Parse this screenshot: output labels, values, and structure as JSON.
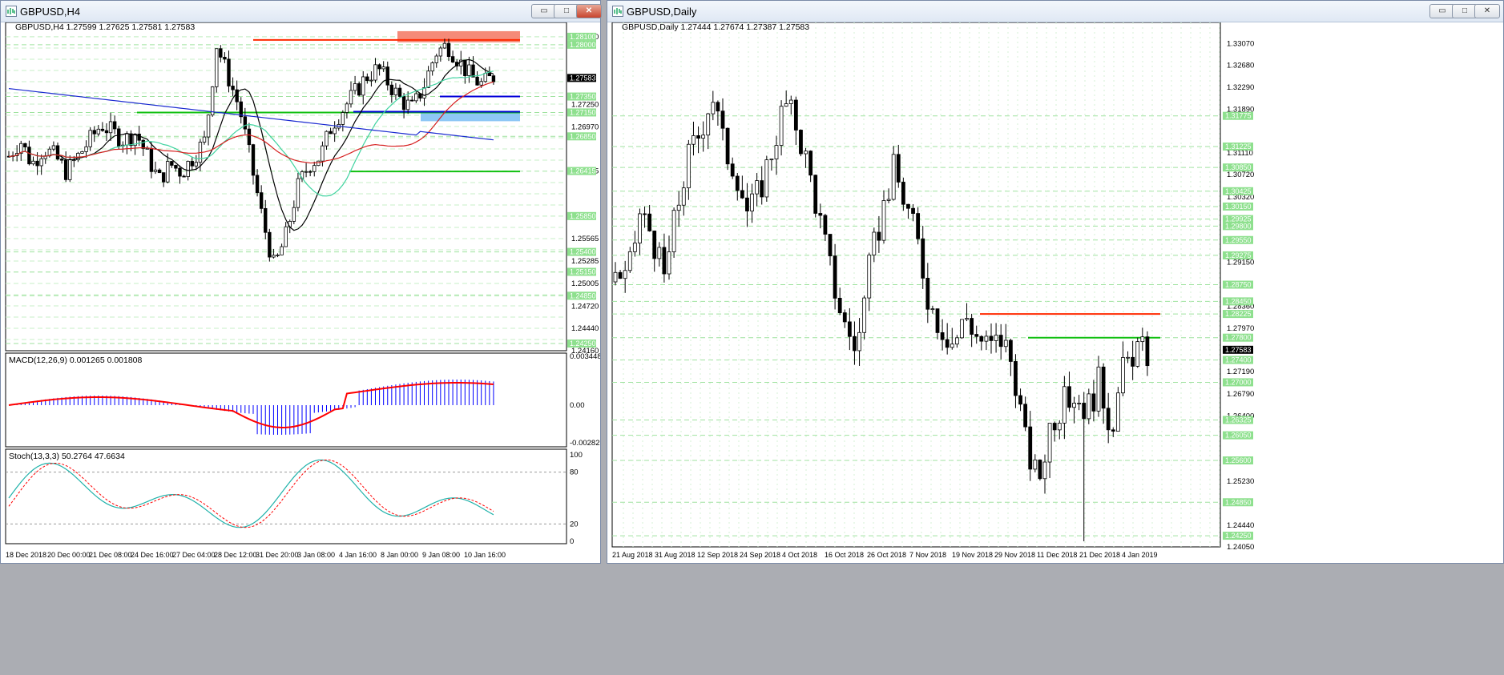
{
  "left": {
    "title": "GBPUSD,H4",
    "symbol_line": "GBPUSD,H4  1.27599 1.27625 1.27581 1.27583",
    "current_price": "1.27583",
    "price_ticks": [
      "1.28100",
      "1.27250",
      "1.26970",
      "1.26415",
      "1.25565",
      "1.25285",
      "1.25005",
      "1.24720",
      "1.24440",
      "1.24160"
    ],
    "green_tags": [
      "1.28100",
      "1.28000",
      "1.27350",
      "1.27150",
      "1.26850",
      "1.26415",
      "1.25850",
      "1.25400",
      "1.25150",
      "1.24850",
      "1.24250"
    ],
    "macd_label": "MACD(12,26,9) 0.001265 0.001808",
    "macd_ticks": [
      "0.003448",
      "0.00",
      "-0.002823"
    ],
    "stoch_label": "Stoch(13,3,3) 50.2764 47.6634",
    "stoch_ticks": [
      "100",
      "80",
      "20",
      "0"
    ],
    "x_labels": [
      "18 Dec 2018",
      "20 Dec 00:00",
      "21 Dec 08:00",
      "24 Dec 16:00",
      "27 Dec 04:00",
      "28 Dec 12:00",
      "31 Dec 20:00",
      "3 Jan 08:00",
      "4 Jan 16:00",
      "8 Jan 00:00",
      "9 Jan 08:00",
      "10 Jan 16:00"
    ]
  },
  "right": {
    "title": "GBPUSD,Daily",
    "symbol_line": "GBPUSD,Daily  1.27444 1.27674 1.27387 1.27583",
    "current_price": "1.27583",
    "price_ticks": [
      "1.33070",
      "1.32680",
      "1.32290",
      "1.31890",
      "1.31110",
      "1.30720",
      "1.30320",
      "1.29150",
      "1.28360",
      "1.27970",
      "1.27190",
      "1.26790",
      "1.26400",
      "1.25230",
      "1.24440",
      "1.24050"
    ],
    "green_tags": [
      "1.31775",
      "1.31225",
      "1.30850",
      "1.30425",
      "1.30150",
      "1.29925",
      "1.29800",
      "1.29550",
      "1.29275",
      "1.28750",
      "1.28450",
      "1.28225",
      "1.27800",
      "1.27400",
      "1.27000",
      "1.26325",
      "1.26050",
      "1.25600",
      "1.24850",
      "1.24250"
    ],
    "x_labels": [
      "21 Aug 2018",
      "31 Aug 2018",
      "12 Sep 2018",
      "24 Sep 2018",
      "4 Oct 2018",
      "16 Oct 2018",
      "26 Oct 2018",
      "7 Nov 2018",
      "19 Nov 2018",
      "29 Nov 2018",
      "11 Dec 2018",
      "21 Dec 2018",
      "4 Jan 2019"
    ]
  },
  "window_buttons": {
    "minimize": "▭",
    "maximize": "□",
    "close": "✕"
  },
  "colors": {
    "support": "#12c012",
    "resistance": "#ff2a00",
    "level_blue": "#0000d8",
    "zone_red": "#f58a78",
    "zone_blue": "#8ec7f5",
    "macd_signal": "#ff0000",
    "macd_hist": "#0000ff",
    "stoch_main": "#20b2aa",
    "stoch_signal": "#ff0000"
  }
}
